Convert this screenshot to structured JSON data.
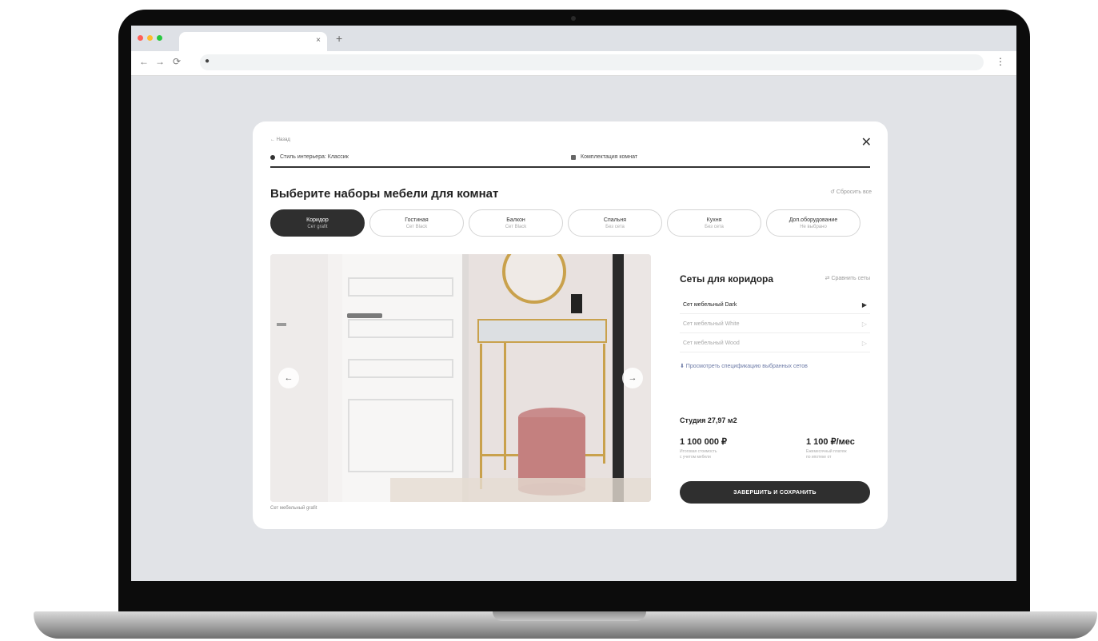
{
  "browser": {
    "tab_close": "×",
    "new_tab": "+",
    "nav": {
      "back": "←",
      "forward": "→",
      "reload": "⟳"
    },
    "lock_icon": "●",
    "menu_icon": "⋮"
  },
  "modal": {
    "back_label": "← Назад",
    "close_icon": "✕",
    "steps": [
      {
        "label": "Стиль интерьера: Классик"
      },
      {
        "label": "Комплектация комнат"
      }
    ],
    "progress_percent": 100,
    "title": "Выберите наборы мебели для комнат",
    "reset_label": "↺ Сбросить все",
    "rooms": [
      {
        "name": "Коридор",
        "sub": "Сет grafit",
        "active": true
      },
      {
        "name": "Гостиная",
        "sub": "Сет Black",
        "active": false
      },
      {
        "name": "Балкон",
        "sub": "Сет Black",
        "active": false
      },
      {
        "name": "Спальня",
        "sub": "Без сета",
        "active": false
      },
      {
        "name": "Кухня",
        "sub": "Без сета",
        "active": false
      },
      {
        "name": "Доп.оборудование",
        "sub": "Не выбрано",
        "active": false
      }
    ],
    "photo_caption": "Сет мебельный grafit",
    "photo_prev": "←",
    "photo_next": "→",
    "sets": {
      "title": "Сеты для коридора",
      "compare": "⇄ Сравнить сеты",
      "items": [
        {
          "label": "Сет мебельный Dark",
          "icon": "▶",
          "selected": true
        },
        {
          "label": "Сет мебельный White",
          "icon": "▷",
          "selected": false
        },
        {
          "label": "Сет мебельный Wood",
          "icon": "▷",
          "selected": false
        }
      ],
      "spec_link": "⬇ Просмотреть спецификацию выбранных сетов"
    },
    "summary": {
      "studio": "Студия 27,97 м2",
      "price_left": "1 100 000 ₽",
      "price_left_sub": "Итоговая стоимость\nс учетом мебели",
      "price_right": "1 100 ₽/мес",
      "price_right_sub": "Ежемесячный платеж\nпо ипотеке от"
    },
    "cta_label": "ЗАВЕРШИТЬ И СОХРАНИТЬ"
  },
  "colors": {
    "accent": "#2f2f2f",
    "screen_bg": "#e1e3e7",
    "link": "#6c7aa6"
  }
}
